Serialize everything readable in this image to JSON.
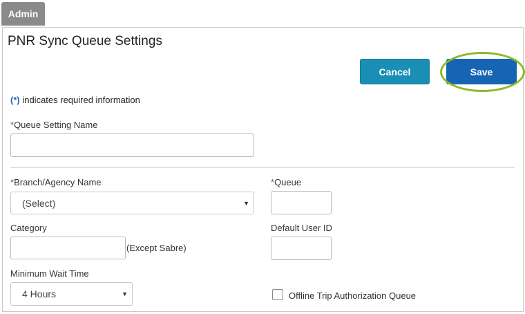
{
  "tab": {
    "label": "Admin"
  },
  "page": {
    "title": "PNR Sync Queue Settings"
  },
  "actions": {
    "cancel_label": "Cancel",
    "save_label": "Save"
  },
  "required_note": {
    "star": "(*)",
    "text": " indicates required information"
  },
  "fields": {
    "queue_setting_name": {
      "required": "*",
      "label": "Queue Setting Name",
      "value": ""
    },
    "branch_agency": {
      "required": "*",
      "label": "Branch/Agency Name",
      "selected": "(Select)"
    },
    "queue": {
      "required": "*",
      "label": "Queue",
      "value": ""
    },
    "category": {
      "label": "Category",
      "value": "",
      "hint": "(Except Sabre)"
    },
    "default_user_id": {
      "label": "Default User ID",
      "value": ""
    },
    "minimum_wait_time": {
      "label": "Minimum Wait Time",
      "selected": "4 Hours"
    },
    "offline_trip_auth": {
      "label": "Offline Trip Authorization Queue",
      "checked": false
    }
  },
  "colors": {
    "cancel": "#1a8fb5",
    "save": "#1565b4",
    "highlight": "#8db928",
    "required": "#2a76c0"
  }
}
